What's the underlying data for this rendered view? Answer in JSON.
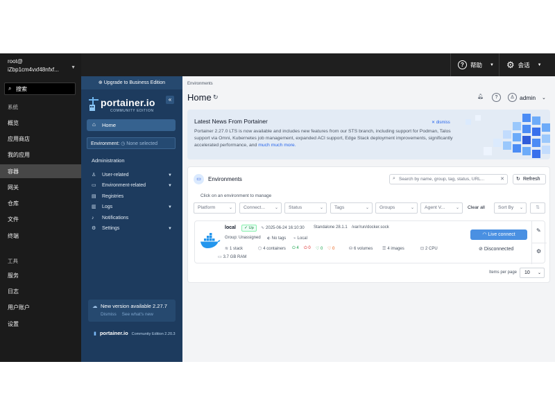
{
  "host": {
    "user_line1": "root@",
    "user_line2": "iZbp1cm4vxf48nfxf...",
    "search_label": "搜索",
    "section_system": "系统",
    "section_tools": "工具",
    "system_items": [
      "概览",
      "应用商店",
      "我的应用",
      "容器",
      "网关",
      "仓库",
      "文件",
      "终端"
    ],
    "tools_items": [
      "服务",
      "日志",
      "用户账户",
      "设置"
    ],
    "active_item": "容器",
    "help_label": "帮助",
    "session_label": "会话"
  },
  "sidebar": {
    "upgrade_label": "Upgrade to Business Edition",
    "brand": "portainer.io",
    "brand_sub": "COMMUNITY EDITION",
    "collapse_glyph": "«",
    "home_label": "Home",
    "environment_label": "Environment:",
    "environment_value": "None selected",
    "admin_heading": "Administration",
    "admin_items": [
      {
        "label": "User-related",
        "icon": "user-icon",
        "expandable": true
      },
      {
        "label": "Environment-related",
        "icon": "environment-icon",
        "expandable": true
      },
      {
        "label": "Registries",
        "icon": "registry-icon",
        "expandable": false
      },
      {
        "label": "Logs",
        "icon": "logs-icon",
        "expandable": true
      },
      {
        "label": "Notifications",
        "icon": "bell-icon",
        "expandable": false
      },
      {
        "label": "Settings",
        "icon": "gear-icon",
        "expandable": true
      }
    ],
    "new_version_label": "New version available 2.27.7",
    "dismiss_label": "Dismiss",
    "whats_new_label": "See what's new",
    "footer_brand": "portainer.io",
    "footer_edition": "Community Edition 2.20.3"
  },
  "main": {
    "breadcrumb": "Environments",
    "title": "Home",
    "user_name": "admin",
    "news": {
      "title": "Latest News From Portainer",
      "dismiss_label": "dismiss",
      "body": "Portainer 2.27.0 LTS is now available and includes new features from our STS branch, including support for Podman, Talos support via Omni, Kubernetes job management, expanded ACI support, Edge Stack deployment improvements, significantly accelerated performance, and",
      "link": "much much more."
    },
    "environments": {
      "title": "Environments",
      "search_placeholder": "Search by name, group, tag, status, URL...",
      "refresh_label": "Refresh",
      "hint": "Click on an environment to manage",
      "filters": [
        "Platform",
        "Connect...",
        "Status",
        "Tags",
        "Groups",
        "Agent V..."
      ],
      "clear_all": "Clear all",
      "sort_by": "Sort By",
      "row": {
        "name": "local",
        "status": "Up",
        "timestamp": "2025-06-24 16:10:30",
        "version": "Standalone 28.1.1",
        "socket": "/var/run/docker.sock",
        "group": "Group: Unassigned",
        "tags": "No tags",
        "location": "Local",
        "stacks": "1 stack",
        "containers": "4 containers",
        "healthy": "4",
        "stopped": "0",
        "running": "0",
        "unhealthy": "0",
        "volumes": "6 volumes",
        "images": "4 images",
        "cpu": "2 CPU",
        "ram": "3.7 GB RAM",
        "live_connect": "Live connect",
        "disconnected": "Disconnected"
      },
      "items_per_page_label": "Items per page",
      "items_per_page_value": "10"
    }
  }
}
